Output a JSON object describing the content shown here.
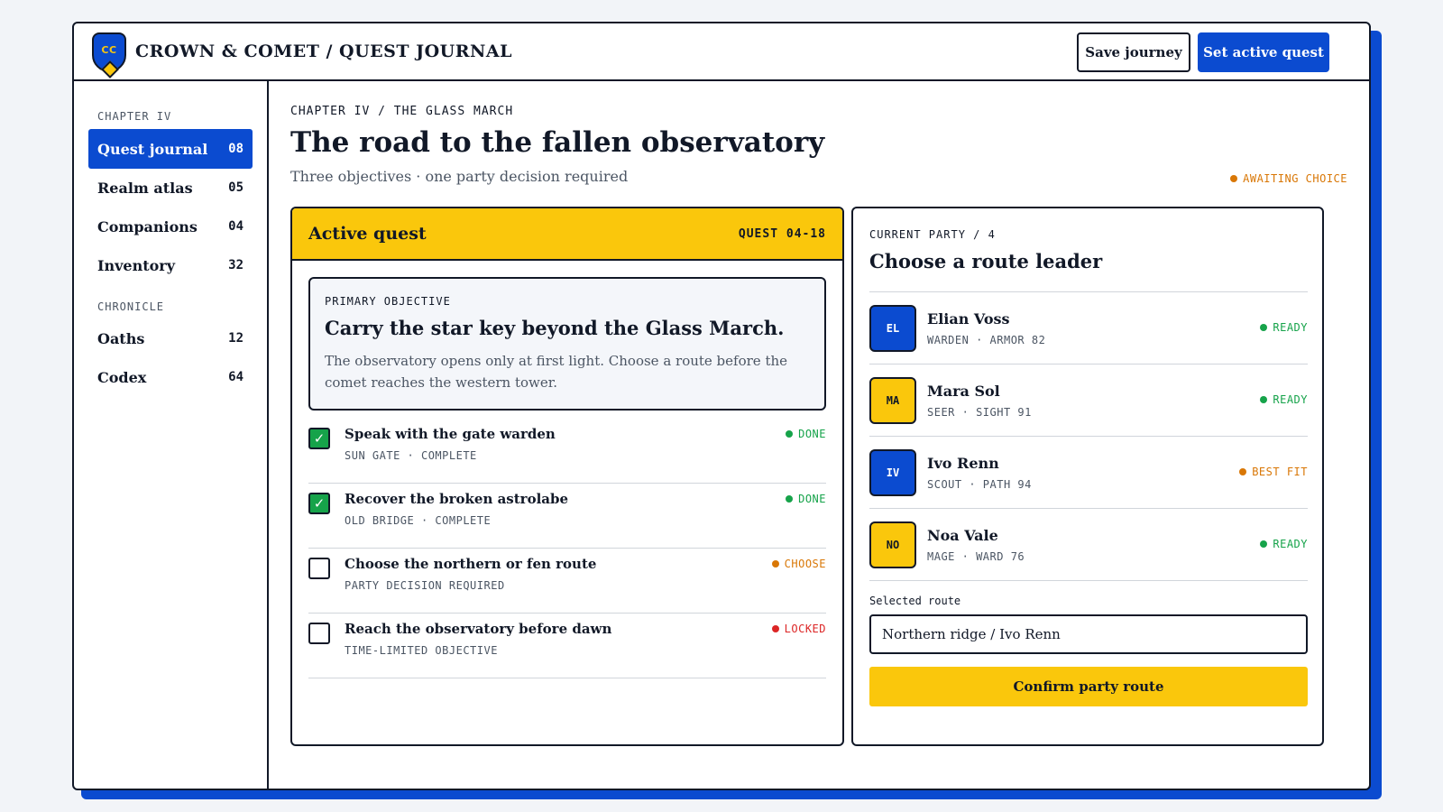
{
  "header": {
    "crest": "CC",
    "brand": "CROWN & COMET / QUEST JOURNAL",
    "save_label": "Save journey",
    "active_label": "Set active quest"
  },
  "sidebar": {
    "section1": "CHAPTER IV",
    "section2": "CHRONICLE",
    "items": [
      {
        "label": "Quest journal",
        "count": "08"
      },
      {
        "label": "Realm atlas",
        "count": "05"
      },
      {
        "label": "Companions",
        "count": "04"
      },
      {
        "label": "Inventory",
        "count": "32"
      },
      {
        "label": "Oaths",
        "count": "12"
      },
      {
        "label": "Codex",
        "count": "64"
      }
    ]
  },
  "main": {
    "crumb": "CHAPTER IV / THE GLASS MARCH",
    "title": "The road to the fallen observatory",
    "subtitle": "Three objectives · one party decision required",
    "status": "AWAITING CHOICE"
  },
  "quest": {
    "title": "Active quest",
    "id": "QUEST 04-18",
    "objective_label": "PRIMARY OBJECTIVE",
    "objective_title": "Carry the star key beyond the Glass March.",
    "objective_desc": "The observatory opens only at first light. Choose a route before the comet reaches the western tower.",
    "tasks": [
      {
        "title": "Speak with the gate warden",
        "meta": "SUN GATE · COMPLETE",
        "status": "DONE",
        "check": "✓"
      },
      {
        "title": "Recover the broken astrolabe",
        "meta": "OLD BRIDGE · COMPLETE",
        "status": "DONE",
        "check": "✓"
      },
      {
        "title": "Choose the northern or fen route",
        "meta": "PARTY DECISION REQUIRED",
        "status": "CHOOSE",
        "check": ""
      },
      {
        "title": "Reach the observatory before dawn",
        "meta": "TIME-LIMITED OBJECTIVE",
        "status": "LOCKED",
        "check": ""
      }
    ]
  },
  "party": {
    "label": "CURRENT PARTY / 4",
    "title": "Choose a route leader",
    "members": [
      {
        "initials": "EL",
        "name": "Elian Voss",
        "meta": "WARDEN · ARMOR 82",
        "status": "READY"
      },
      {
        "initials": "MA",
        "name": "Mara Sol",
        "meta": "SEER · SIGHT 91",
        "status": "READY"
      },
      {
        "initials": "IV",
        "name": "Ivo Renn",
        "meta": "SCOUT · PATH 94",
        "status": "BEST FIT"
      },
      {
        "initials": "NO",
        "name": "Noa Vale",
        "meta": "MAGE · WARD 76",
        "status": "READY"
      }
    ],
    "route_label": "Selected route",
    "route_value": "Northern ridge / Ivo Renn",
    "confirm_label": "Confirm party route"
  },
  "colors": {
    "blue": "#0b4bd0",
    "gold": "#fac70c",
    "done": "#16a34a",
    "choose": "#d97706",
    "locked": "#dc2626"
  }
}
